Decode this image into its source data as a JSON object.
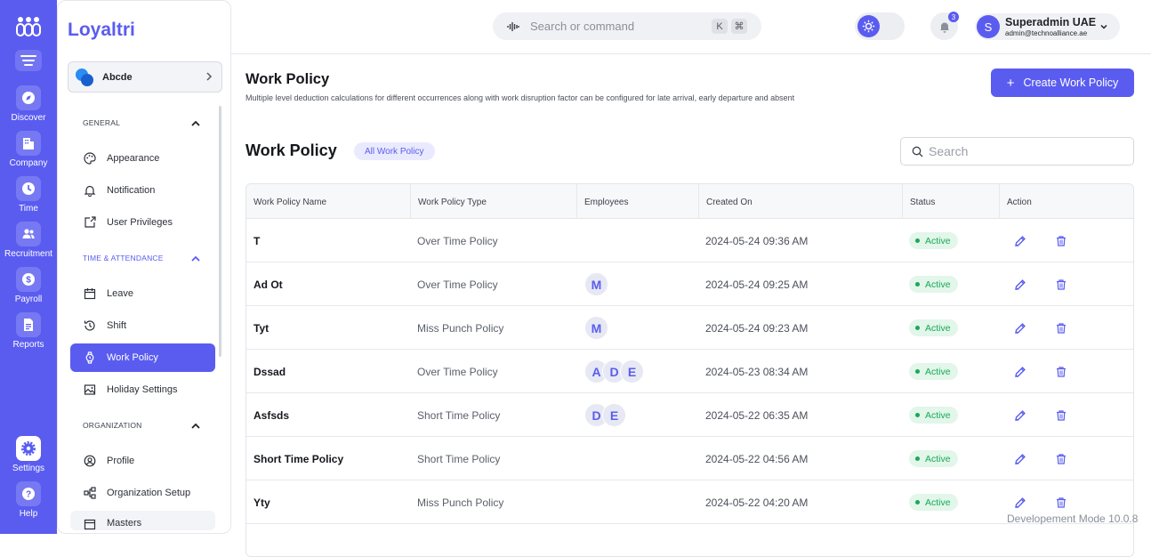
{
  "rail": {
    "items": [
      {
        "label": "Discover",
        "icon": "compass-icon"
      },
      {
        "label": "Company",
        "icon": "building-icon"
      },
      {
        "label": "Time",
        "icon": "clock-icon"
      },
      {
        "label": "Recruitment",
        "icon": "users-icon"
      },
      {
        "label": "Payroll",
        "icon": "dollar-icon"
      },
      {
        "label": "Reports",
        "icon": "document-icon"
      }
    ],
    "bottom": [
      {
        "label": "Settings",
        "icon": "gear-icon"
      },
      {
        "label": "Help",
        "icon": "help-icon"
      }
    ]
  },
  "sidebar": {
    "brand": "Loyaltri",
    "org_name": "Abcde",
    "sections": {
      "general": "GENERAL",
      "time": "TIME & ATTENDANCE",
      "org": "ORGANIZATION"
    },
    "items": [
      {
        "label": "Appearance"
      },
      {
        "label": "Notification"
      },
      {
        "label": "User Privileges"
      },
      {
        "label": "Leave"
      },
      {
        "label": "Shift"
      },
      {
        "label": "Work Policy"
      },
      {
        "label": "Holiday Settings"
      },
      {
        "label": "Profile"
      },
      {
        "label": "Organization Setup"
      },
      {
        "label": "Masters"
      }
    ]
  },
  "topbar": {
    "search_placeholder": "Search or command",
    "kbd_k": "K",
    "kbd_cmd": "⌘",
    "notification_count": "3",
    "user_initial": "S",
    "user_name": "Superadmin UAE",
    "user_email": "admin@technoalliance.ae"
  },
  "page": {
    "title": "Work Policy",
    "description": "Multiple level deduction calculations for different occurrences along with work disruption factor can be configured for late arrival, early departure and absent",
    "create_button": "Create Work Policy",
    "section_title": "Work Policy",
    "filter_chip": "All Work Policy",
    "search_placeholder": "Search"
  },
  "table": {
    "headers": [
      "Work Policy Name",
      "Work Policy Type",
      "Employees",
      "Created On",
      "Status",
      "Action"
    ],
    "rows": [
      {
        "name": "T",
        "type": "Over Time Policy",
        "employees": [],
        "created": "2024-05-24 09:36 AM",
        "status": "Active"
      },
      {
        "name": "Ad Ot",
        "type": "Over Time Policy",
        "employees": [
          "M"
        ],
        "created": "2024-05-24 09:25 AM",
        "status": "Active"
      },
      {
        "name": "Tyt",
        "type": "Miss Punch Policy",
        "employees": [
          "M"
        ],
        "created": "2024-05-24 09:23 AM",
        "status": "Active"
      },
      {
        "name": "Dssad",
        "type": "Over Time Policy",
        "employees": [
          "A",
          "D",
          "E"
        ],
        "created": "2024-05-23 08:34 AM",
        "status": "Active"
      },
      {
        "name": "Asfsds",
        "type": "Short Time Policy",
        "employees": [
          "D",
          "E"
        ],
        "created": "2024-05-22 06:35 AM",
        "status": "Active"
      },
      {
        "name": "Short Time Policy",
        "type": "Short Time Policy",
        "employees": [],
        "created": "2024-05-22 04:56 AM",
        "status": "Active"
      },
      {
        "name": "Yty",
        "type": "Miss Punch Policy",
        "employees": [],
        "created": "2024-05-22 04:20 AM",
        "status": "Active"
      }
    ]
  },
  "footer": {
    "dev_mode": "Developement Mode 10.0.8"
  },
  "colors": {
    "accent": "#5a5cf0",
    "active_status": "#18a957"
  }
}
